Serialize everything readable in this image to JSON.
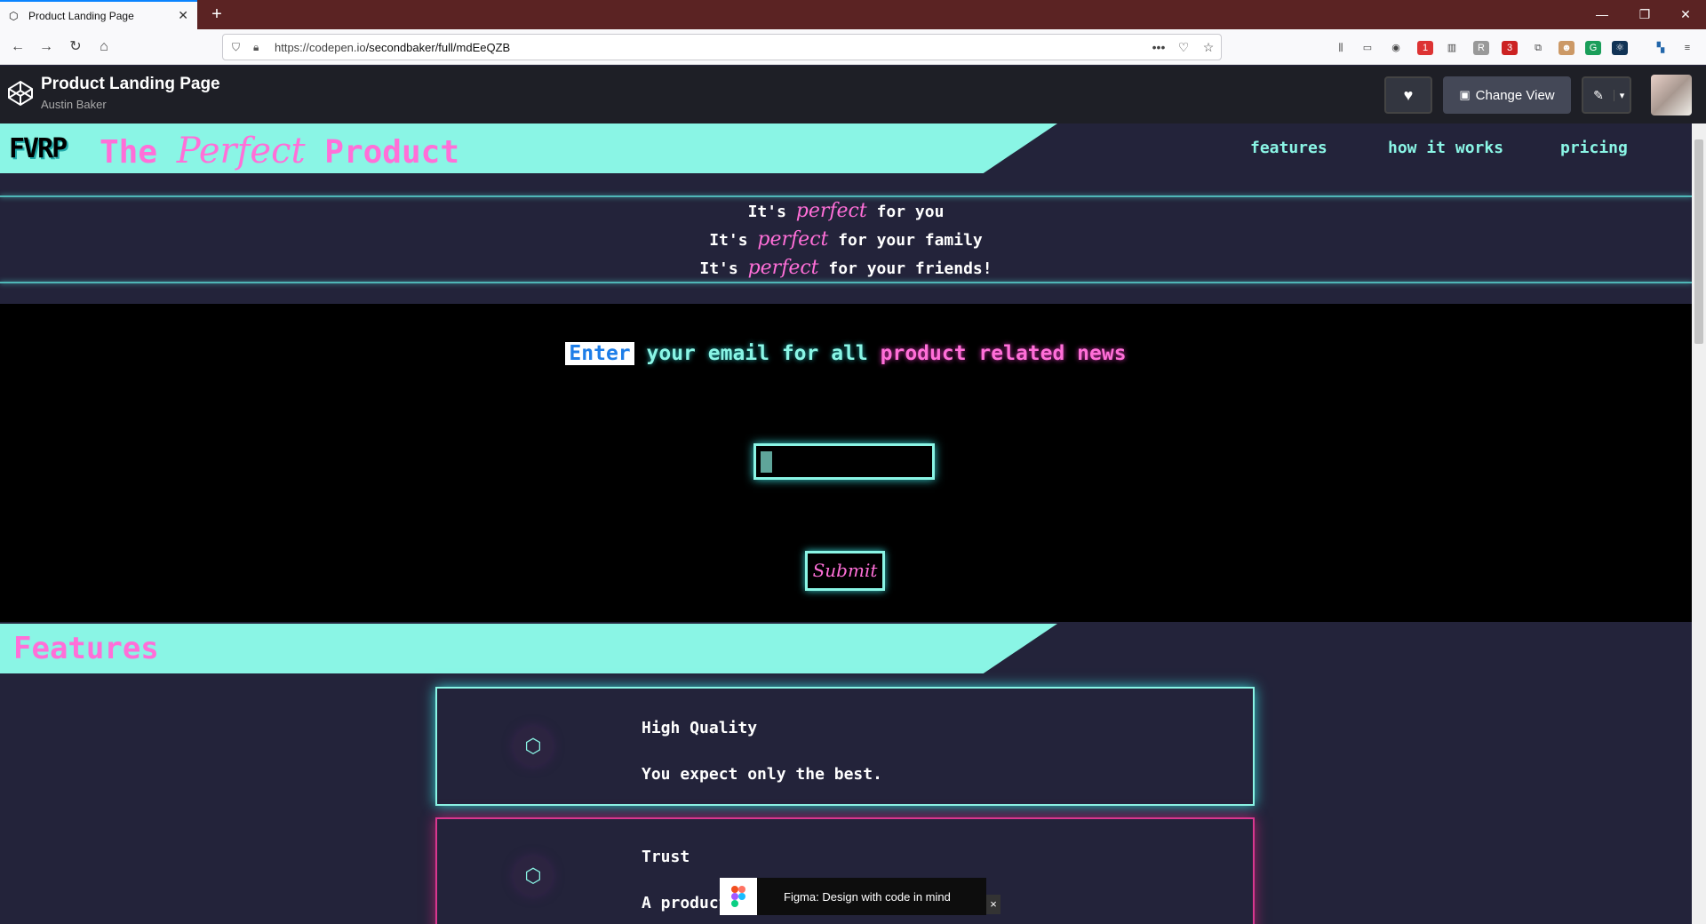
{
  "browser": {
    "tab_title": "Product Landing Page",
    "new_tab": "+",
    "url_host": "https://codepen.io",
    "url_path": "/secondbaker/full/mdEeQZB",
    "url_more": "•••",
    "badge_1": "1",
    "badge_3": "3"
  },
  "codepen": {
    "title": "Product Landing Page",
    "author": "Austin Baker",
    "change_view": "Change View"
  },
  "site": {
    "logo": "FVRP",
    "brand_the": "The",
    "brand_perfect": "Perfect",
    "brand_product": "Product",
    "nav": [
      "features",
      "how it works",
      "pricing"
    ],
    "taglines": [
      {
        "pre": "It's",
        "em": "perfect",
        "post": "for you"
      },
      {
        "pre": "It's",
        "em": "perfect",
        "post": "for your family"
      },
      {
        "pre": "It's",
        "em": "perfect",
        "post": "for your friends!"
      }
    ],
    "email_head_sel": "Enter",
    "email_head_mid": " your email for all ",
    "email_head_pink": "product related news",
    "submit_label": "Submit",
    "features_title": "Features",
    "cards": [
      {
        "title": "High Quality",
        "desc": "You expect only the best."
      },
      {
        "title": "Trust",
        "desc": "A product"
      }
    ]
  },
  "figma": {
    "text": "Figma: Design with code in mind",
    "close": "×"
  },
  "colors": {
    "accent_cyan": "#8af5e5",
    "accent_pink": "#ff6fd8",
    "background": "#23233a"
  }
}
